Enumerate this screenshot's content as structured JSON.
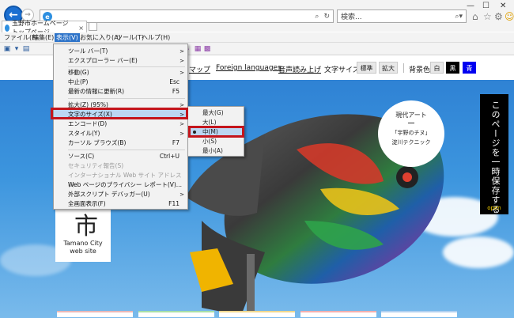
{
  "browser": {
    "search_placeholder": "検索...",
    "tab_title": "玉野市ホームページ トップページ",
    "menus": [
      "ファイル(F)",
      "編集(E)",
      "表示(V)",
      "お気に入り(A)",
      "ツール(T)",
      "ヘルプ(H)"
    ],
    "active_menu_index": 2
  },
  "view_menu": {
    "items": [
      {
        "label": "ツール バー(T)",
        "shortcut": "",
        "submenu": true
      },
      {
        "label": "エクスプローラー バー(E)",
        "shortcut": "",
        "submenu": true
      },
      {
        "label": "移動(G)",
        "shortcut": "",
        "submenu": true
      },
      {
        "label": "中止(P)",
        "shortcut": "Esc",
        "submenu": false
      },
      {
        "label": "最新の情報に更新(R)",
        "shortcut": "F5",
        "submenu": false
      },
      {
        "label": "拡大(Z) (95%)",
        "shortcut": "",
        "submenu": true
      },
      {
        "label": "文字のサイズ(X)",
        "shortcut": "",
        "submenu": true
      },
      {
        "label": "エンコード(D)",
        "shortcut": "",
        "submenu": true
      },
      {
        "label": "スタイル(Y)",
        "shortcut": "",
        "submenu": true
      },
      {
        "label": "カーソル ブラウズ(B)",
        "shortcut": "F7",
        "submenu": false
      },
      {
        "label": "ソース(C)",
        "shortcut": "Ctrl+U",
        "submenu": false
      },
      {
        "label": "セキュリティ報告(S)",
        "shortcut": "",
        "submenu": false
      },
      {
        "label": "インターナショナル Web サイト アドレス(I)",
        "shortcut": "",
        "submenu": false
      },
      {
        "label": "Web ページのプライバシー レポート(V)...",
        "shortcut": "",
        "submenu": false
      },
      {
        "label": "外部スクリプト デバッガー(U)",
        "shortcut": "",
        "submenu": true
      },
      {
        "label": "全画面表示(F)",
        "shortcut": "F11",
        "submenu": false
      }
    ]
  },
  "text_size_menu": {
    "items": [
      "最大(G)",
      "大(L)",
      "中(M)",
      "小(S)",
      "最小(A)"
    ],
    "selected_index": 2
  },
  "site": {
    "links": {
      "map": "マップ",
      "foreign": "Foreign languages",
      "speech": "音声読み上げ"
    },
    "font_size_label": "文字サイズ",
    "font_standard": "標準",
    "font_large": "拡大",
    "bg_color_label": "背景色",
    "bg_white": "白",
    "bg_black": "黒",
    "bg_blue": "青",
    "logo_kanji": "市",
    "logo_en_line1": "Tamano City",
    "logo_en_line2": "web site",
    "art_badge": {
      "title": "現代アート",
      "line1": "「宇野のチヌ」",
      "line2": "淀川テクニック"
    },
    "side_tab_text": "このページを一時保存する",
    "side_tab_open": "open"
  },
  "colors": {
    "menu_active": "#2e74c9",
    "highlight": "#bcd7f2",
    "callout_red": "#c4151c",
    "bg_blue_button": "#0000f0"
  }
}
